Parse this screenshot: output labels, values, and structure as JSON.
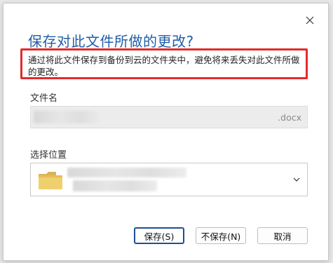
{
  "dialog": {
    "title": "保存对此文件所做的更改?",
    "message": "通过将此文件保存到备份到云的文件夹中，避免将来丢失对此文件所做的更改。",
    "close_icon": "close-icon"
  },
  "file_name": {
    "label": "文件名",
    "extension": ".docx"
  },
  "location": {
    "label": "选择位置",
    "icon": "folder-icon"
  },
  "buttons": {
    "save": "保存(S)",
    "dont_save": "不保存(N)",
    "cancel": "取消"
  },
  "colors": {
    "title": "#1f5fa8",
    "highlight_border": "#e32b2b",
    "primary_button_border": "#1c4f95"
  }
}
